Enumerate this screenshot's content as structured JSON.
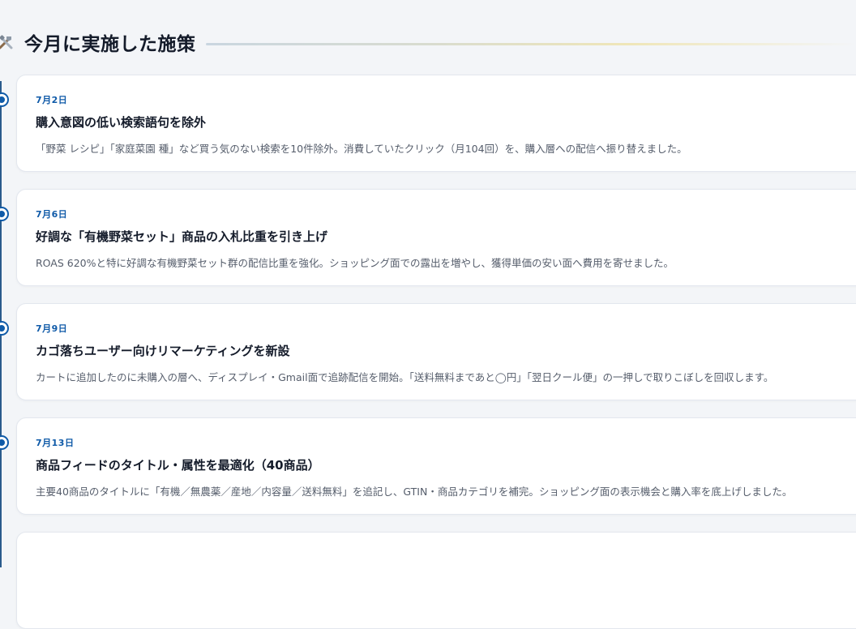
{
  "section": {
    "icon": "tools-icon",
    "title": "今月に実施した施策"
  },
  "timeline": {
    "items": [
      {
        "date": "7月2日",
        "title": "購入意図の低い検索語句を除外",
        "description": "「野菜 レシピ」「家庭菜園 種」など買う気のない検索を10件除外。消費していたクリック（月104回）を、購入層への配信へ振り替えました。"
      },
      {
        "date": "7月6日",
        "title": "好調な「有機野菜セット」商品の入札比重を引き上げ",
        "description": "ROAS 620%と特に好調な有機野菜セット群の配信比重を強化。ショッピング面での露出を増やし、獲得単価の安い面へ費用を寄せました。"
      },
      {
        "date": "7月9日",
        "title": "カゴ落ちユーザー向けリマーケティングを新設",
        "description": "カートに追加したのに未購入の層へ、ディスプレイ・Gmail面で追跡配信を開始。「送料無料まであと◯円」「翌日クール便」の一押しで取りこぼしを回収します。"
      },
      {
        "date": "7月13日",
        "title": "商品フィードのタイトル・属性を最適化（40商品）",
        "description": "主要40商品のタイトルに「有機／無農薬／産地／内容量／送料無料」を追記し、GTIN・商品カテゴリを補完。ショッピング面の表示機会と購入率を底上げしました。"
      }
    ]
  },
  "colors": {
    "accent": "#0f5aa8",
    "background": "#f3f5f8",
    "card": "#ffffff"
  }
}
